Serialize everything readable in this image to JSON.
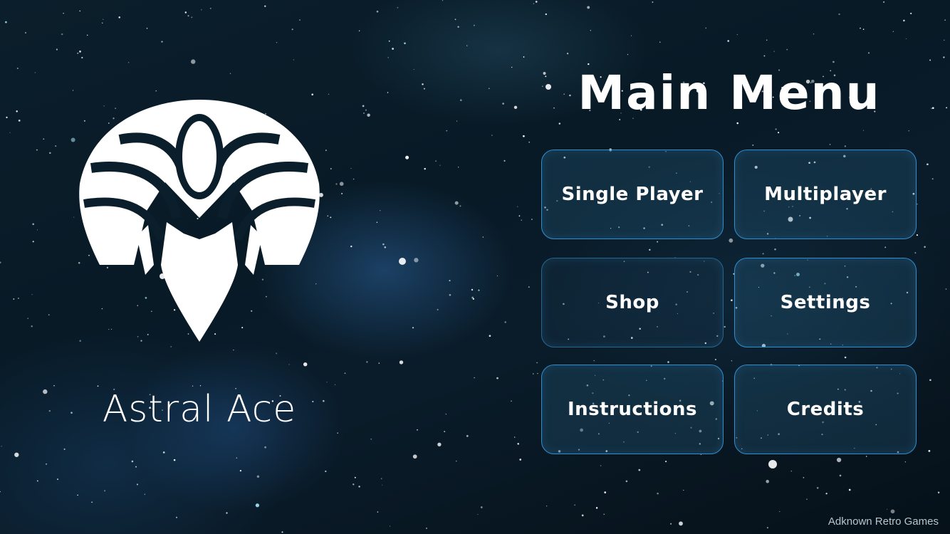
{
  "game": {
    "title": "Astral Ace",
    "logo_icon": "astral-ace-emblem-icon"
  },
  "menu": {
    "title": "Main Menu",
    "buttons": [
      {
        "label": "Single Player"
      },
      {
        "label": "Multiplayer"
      },
      {
        "label": "Shop"
      },
      {
        "label": "Settings"
      },
      {
        "label": "Instructions"
      },
      {
        "label": "Credits"
      }
    ]
  },
  "footer": {
    "studio": "Adknown Retro Games"
  },
  "colors": {
    "background": "#081a26",
    "button_border": "#2f8fd0",
    "text": "#ffffff"
  }
}
